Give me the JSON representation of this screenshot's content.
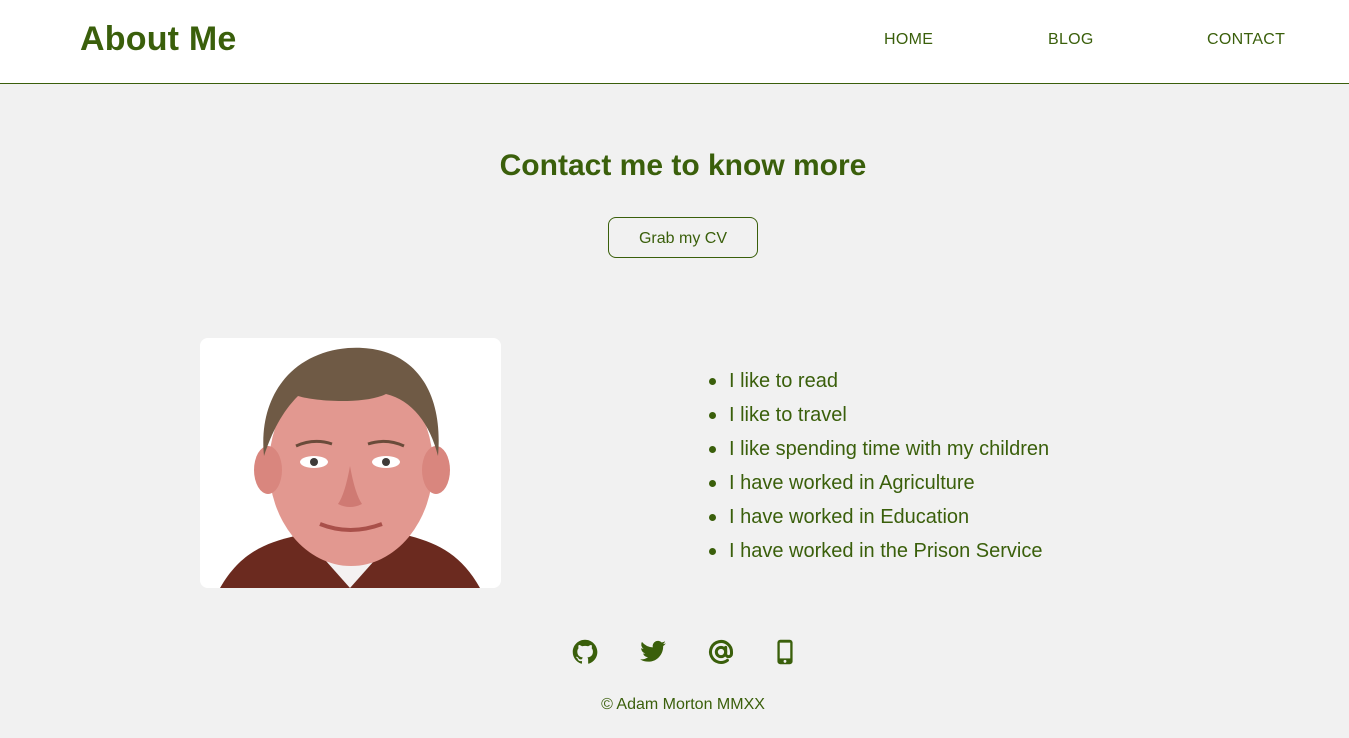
{
  "header": {
    "title": "About Me",
    "nav": {
      "home": "HOME",
      "blog": "BLOG",
      "contact": "CONTACT"
    }
  },
  "main": {
    "heading": "Contact me to know more",
    "cv_button": "Grab my CV",
    "portrait": "portrait-photo",
    "facts": [
      "I like to read",
      "I like to travel",
      "I like spending time with my children",
      "I have worked in Agriculture",
      "I have worked in Education",
      "I have worked in the Prison Service"
    ]
  },
  "footer": {
    "social_icons": [
      "github-icon",
      "twitter-icon",
      "email-at-icon",
      "phone-icon"
    ],
    "copyright": "© Adam Morton MMXX"
  },
  "colors": {
    "accent": "#3a5f0b",
    "background": "#f1f1f1",
    "header_background": "#ffffff"
  }
}
